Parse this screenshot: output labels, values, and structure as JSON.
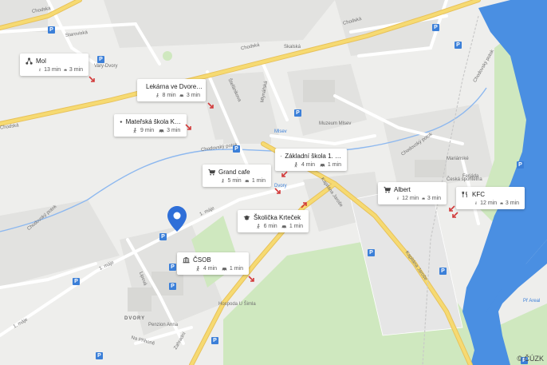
{
  "copyright": "© ČÚZK",
  "street_labels": [
    {
      "key": "staroveska",
      "text": "Staroviská"
    },
    {
      "key": "chodska1",
      "text": "Chodská"
    },
    {
      "key": "chodska2",
      "text": "Chodská"
    },
    {
      "key": "chodska3",
      "text": "Chodská"
    },
    {
      "key": "chodska4",
      "text": "Chodská"
    },
    {
      "key": "skalska",
      "text": "Skalská"
    },
    {
      "key": "stefanikova",
      "text": "Štefánikova"
    },
    {
      "key": "mlynarka",
      "text": "Mlynářská"
    },
    {
      "key": "chodovsky_potok1",
      "text": "Chodovský potok"
    },
    {
      "key": "chodovsky_potok2",
      "text": "Chodovský potok"
    },
    {
      "key": "chodovsky_potok3",
      "text": "Chodovský potok"
    },
    {
      "key": "chodovsky_potok4",
      "text": "Chodovský potok"
    },
    {
      "key": "maja1",
      "text": "1. máje"
    },
    {
      "key": "maja2",
      "text": "1. máje"
    },
    {
      "key": "maja3",
      "text": "1. máje"
    },
    {
      "key": "lipova",
      "text": "Lipová"
    },
    {
      "key": "zahradni",
      "text": "Zahradní"
    },
    {
      "key": "na_prihone",
      "text": "Na Příhoně"
    },
    {
      "key": "kpt_jarose1",
      "text": "Kapitána Jaroše"
    },
    {
      "key": "kpt_jarose2",
      "text": "Kapitána Jaroše"
    },
    {
      "key": "dvory",
      "text": "DVORY"
    },
    {
      "key": "vary_dvory",
      "text": "Vary-Dvory"
    },
    {
      "key": "muzeum",
      "text": "Muzeum Mlsev"
    },
    {
      "key": "marianske",
      "text": "Mariánské"
    },
    {
      "key": "ceska_sporitelna",
      "text": "Česká spořitelna"
    },
    {
      "key": "penzion",
      "text": "Penzion Anna"
    },
    {
      "key": "hospoda",
      "text": "Hospoda U Šimla"
    },
    {
      "key": "mlsev",
      "text": "Mlsev"
    },
    {
      "key": "ferjada",
      "text": "Ferjáda"
    },
    {
      "key": "pr_kemp",
      "text": "Př Areal"
    },
    {
      "key": "dvory_school",
      "text": "Dvory"
    }
  ],
  "pois": [
    {
      "key": "mol",
      "name": "Mol",
      "icon": "network-icon",
      "walk": "13 min",
      "car": "3 min"
    },
    {
      "key": "lekarna",
      "name": "Lekárna ve Dvore…",
      "icon": "pharmacy-icon",
      "walk": "8 min",
      "car": "3 min"
    },
    {
      "key": "materska",
      "name": "Mateřská škola K…",
      "icon": "school-icon",
      "walk": "9 min",
      "car": "3 min"
    },
    {
      "key": "zakladni",
      "name": "Základní škola 1. …",
      "icon": "school-icon",
      "walk": "4 min",
      "car": "1 min"
    },
    {
      "key": "grandcafe",
      "name": "Grand cafe",
      "icon": "cart-icon",
      "walk": "5 min",
      "car": "1 min"
    },
    {
      "key": "skolicka",
      "name": "Školička Krteček",
      "icon": "school-icon",
      "walk": "6 min",
      "car": "1 min"
    },
    {
      "key": "albert",
      "name": "Albert",
      "icon": "cart-icon",
      "walk": "12 min",
      "car": "3 min"
    },
    {
      "key": "kfc",
      "name": "KFC",
      "icon": "restaurant-icon",
      "walk": "12 min",
      "car": "3 min"
    },
    {
      "key": "csob",
      "name": "ČSOB",
      "icon": "bank-icon",
      "walk": "4 min",
      "car": "1 min"
    }
  ],
  "colors": {
    "land": "#eeeeec",
    "road_major": "#f6da72",
    "road_minor": "#ffffff",
    "water": "#4a8fe2",
    "park": "#c7e5b4",
    "pin": "#2f6fd8",
    "parking": "#3b7fd8"
  }
}
